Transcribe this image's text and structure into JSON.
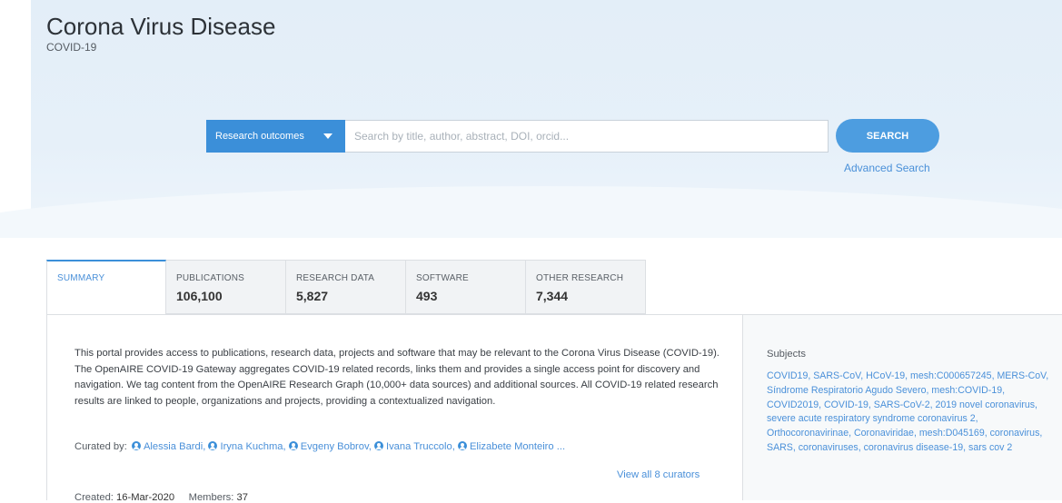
{
  "header": {
    "title": "Corona Virus Disease",
    "subtitle": "COVID-19"
  },
  "search": {
    "type_label": "Research outcomes",
    "placeholder": "Search by title, author, abstract, DOI, orcid...",
    "value": "",
    "button_label": "SEARCH",
    "advanced_label": "Advanced Search"
  },
  "tabs": [
    {
      "label": "SUMMARY",
      "count": ""
    },
    {
      "label": "PUBLICATIONS",
      "count": "106,100"
    },
    {
      "label": "RESEARCH DATA",
      "count": "5,827"
    },
    {
      "label": "SOFTWARE",
      "count": "493"
    },
    {
      "label": "OTHER RESEARCH",
      "count": "7,344"
    }
  ],
  "summary": {
    "description": "This portal provides access to publications, research data, projects and software that may be relevant to the Corona Virus Disease (COVID-19). The OpenAIRE COVID-19 Gateway aggregates COVID-19 related records, links them and provides a single access point for discovery and navigation. We tag content from the OpenAIRE Research Graph (10,000+ data sources) and additional sources. All COVID-19 related research results are linked to people, organizations and projects, providing a contextualized navigation.",
    "curated_label": "Curated by:",
    "curators": [
      "Alessia Bardi,",
      "Iryna Kuchma,",
      "Evgeny Bobrov,",
      "Ivana Truccolo,",
      "Elizabete Monteiro ..."
    ],
    "view_all": "View all 8 curators",
    "created_label": "Created:",
    "created_value": "16-Mar-2020",
    "members_label": "Members:",
    "members_value": "37"
  },
  "subjects": {
    "title": "Subjects",
    "items": [
      "COVID19,",
      "SARS-CoV,",
      "HCoV-19,",
      "mesh:C000657245,",
      "MERS-CoV,",
      "Síndrome Respiratorio Agudo Severo,",
      "mesh:COVID-19,",
      "COVID2019,",
      "COVID-19,",
      "SARS-CoV-2,",
      "2019 novel coronavirus,",
      "severe acute respiratory syndrome coronavirus 2,",
      "Orthocoronavirinae,",
      "Coronaviridae,",
      "mesh:D045169,",
      "coronavirus,",
      "SARS,",
      "coronaviruses,",
      "coronavirus disease-19,",
      "sars cov 2"
    ]
  },
  "colors": {
    "accent": "#3b8fd9",
    "link": "#4a90d9",
    "hero_bg": "#e3eef8"
  }
}
